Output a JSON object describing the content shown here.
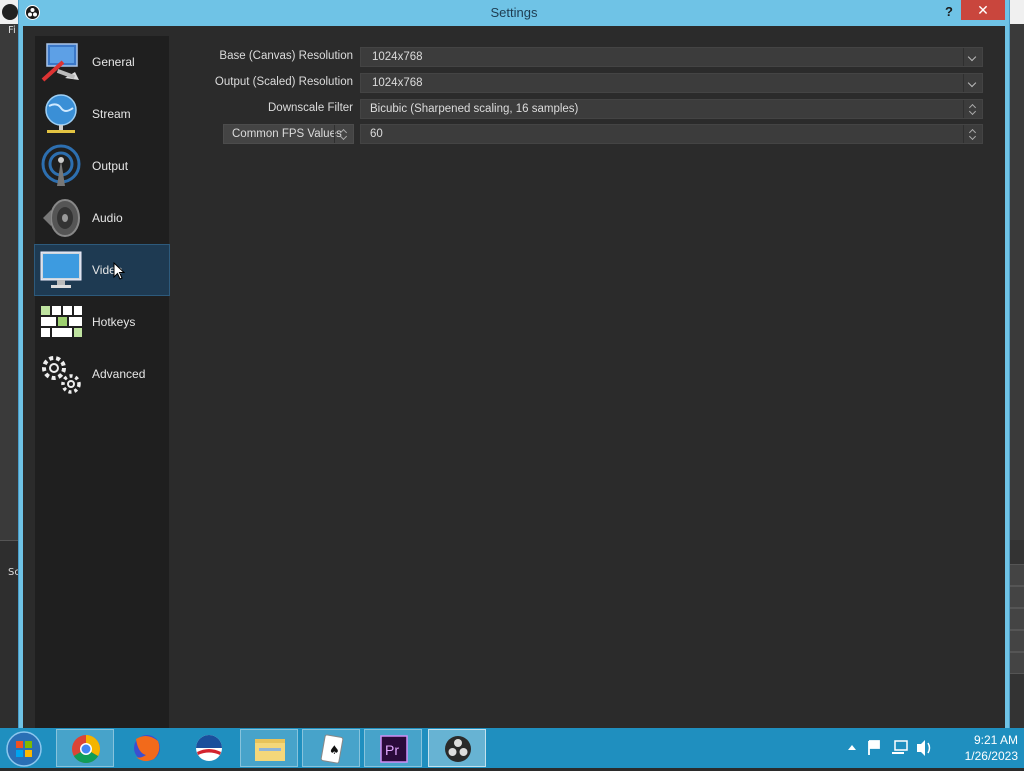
{
  "background_app": {
    "menu_first_letters": "Fi",
    "scenes_label_fragment": "Sc"
  },
  "dialog": {
    "title": "Settings",
    "help_label": "?",
    "close_label": "✕"
  },
  "sidebar": {
    "items": [
      {
        "label": "General",
        "icon": "general-settings-icon"
      },
      {
        "label": "Stream",
        "icon": "globe-network-icon"
      },
      {
        "label": "Output",
        "icon": "broadcast-antenna-icon"
      },
      {
        "label": "Audio",
        "icon": "speaker-icon"
      },
      {
        "label": "Video",
        "icon": "monitor-icon",
        "active": true
      },
      {
        "label": "Hotkeys",
        "icon": "keyboard-icon"
      },
      {
        "label": "Advanced",
        "icon": "gears-icon"
      }
    ]
  },
  "video": {
    "base_resolution": {
      "label": "Base (Canvas) Resolution",
      "value": "1024x768"
    },
    "output_resolution": {
      "label": "Output (Scaled) Resolution",
      "value": "1024x768"
    },
    "downscale_filter": {
      "label": "Downscale Filter",
      "value": "Bicubic (Sharpened scaling, 16 samples)"
    },
    "fps": {
      "label": "Common FPS Values",
      "value": "60"
    }
  },
  "taskbar": {
    "apps": [
      {
        "name": "chrome-icon"
      },
      {
        "name": "firefox-icon"
      },
      {
        "name": "obama-logo-icon"
      },
      {
        "name": "file-explorer-icon"
      },
      {
        "name": "solitaire-icon"
      },
      {
        "name": "premiere-pro-icon",
        "text": "Pr"
      },
      {
        "name": "obs-icon",
        "active": true
      }
    ],
    "clock": {
      "time": "9:21 AM",
      "date": "1/26/2023"
    }
  },
  "colors": {
    "dialog_titlebar": "#6fc3e6",
    "panel_bg": "#2b2b2b",
    "sidebar_bg": "#1f1f1f",
    "active_item": "#1e3a52",
    "taskbar": "#1f8fbf",
    "close_button": "#c9463d"
  }
}
